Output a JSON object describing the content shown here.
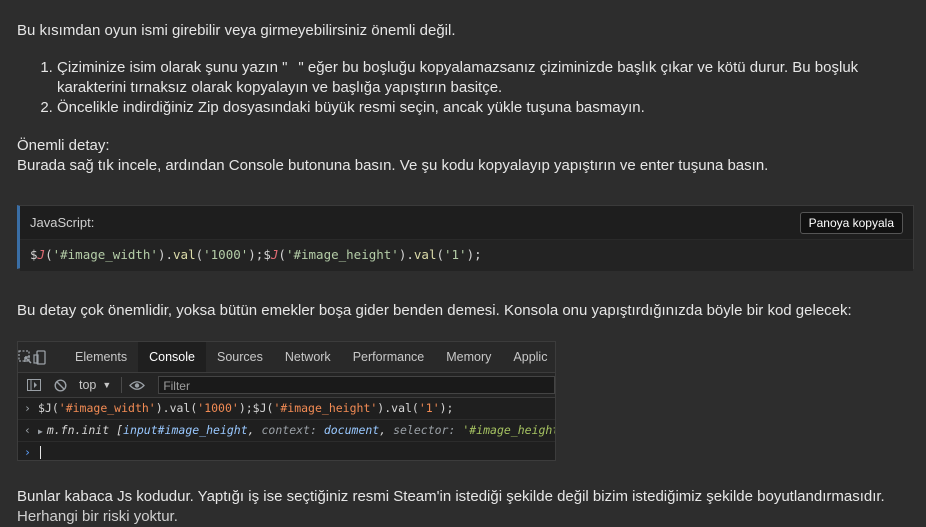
{
  "intro": "Bu kısımdan oyun ismi girebilir veya girmeyebilirsiniz önemli değil.",
  "steps": [
    "Çiziminize isim olarak şunu yazın \"⠀\" eğer bu boşluğu kopyalamazsanız çiziminizde başlık çıkar ve kötü durur. Bu boşluk karakterini tırnaksız olarak kopyalayın ve başlığa yapıştırın basitçe.",
    "Öncelikle indirdiğiniz Zip dosyasındaki büyük resmi seçin, ancak yükle tuşuna basmayın."
  ],
  "important_title": "Önemli detay:",
  "important_text": "Burada sağ tık incele, ardından Console butonuna basın. Ve şu kodu kopyalayıp yapıştırın ve enter tuşuna basın.",
  "code_block": {
    "language": "JavaScript:",
    "copy_label": "Panoya kopyala",
    "code": "$J('#image_width').val('1000');$J('#image_height').val('1');"
  },
  "after_code": "Bu detay çok önemlidir, yoksa bütün emekler boşa gider benden demesi. Konsola onu yapıştırdığınızda böyle bir kod gelecek:",
  "devtools": {
    "tabs": [
      "Elements",
      "Console",
      "Sources",
      "Network",
      "Performance",
      "Memory",
      "Applic"
    ],
    "active_tab": "Console",
    "context": "top",
    "filter_placeholder": "Filter",
    "input_line": "$J('#image_width').val('1000');$J('#image_height').val('1');",
    "output_prefix": "m.fn.init",
    "output_sel_elem": "input#image_height",
    "output_context_key": "context:",
    "output_context_val": "document",
    "output_selector_key": "selector:",
    "output_selector_val": "'#image_height'"
  },
  "closing": "Bunlar kabaca Js kodudur. Yaptığı iş ise seçtiğiniz resmi Steam'in istediği şekilde değil bizim istediğimiz şekilde boyutlandırmasıdır.",
  "closing_cut": "Herhangi bir riski yoktur."
}
